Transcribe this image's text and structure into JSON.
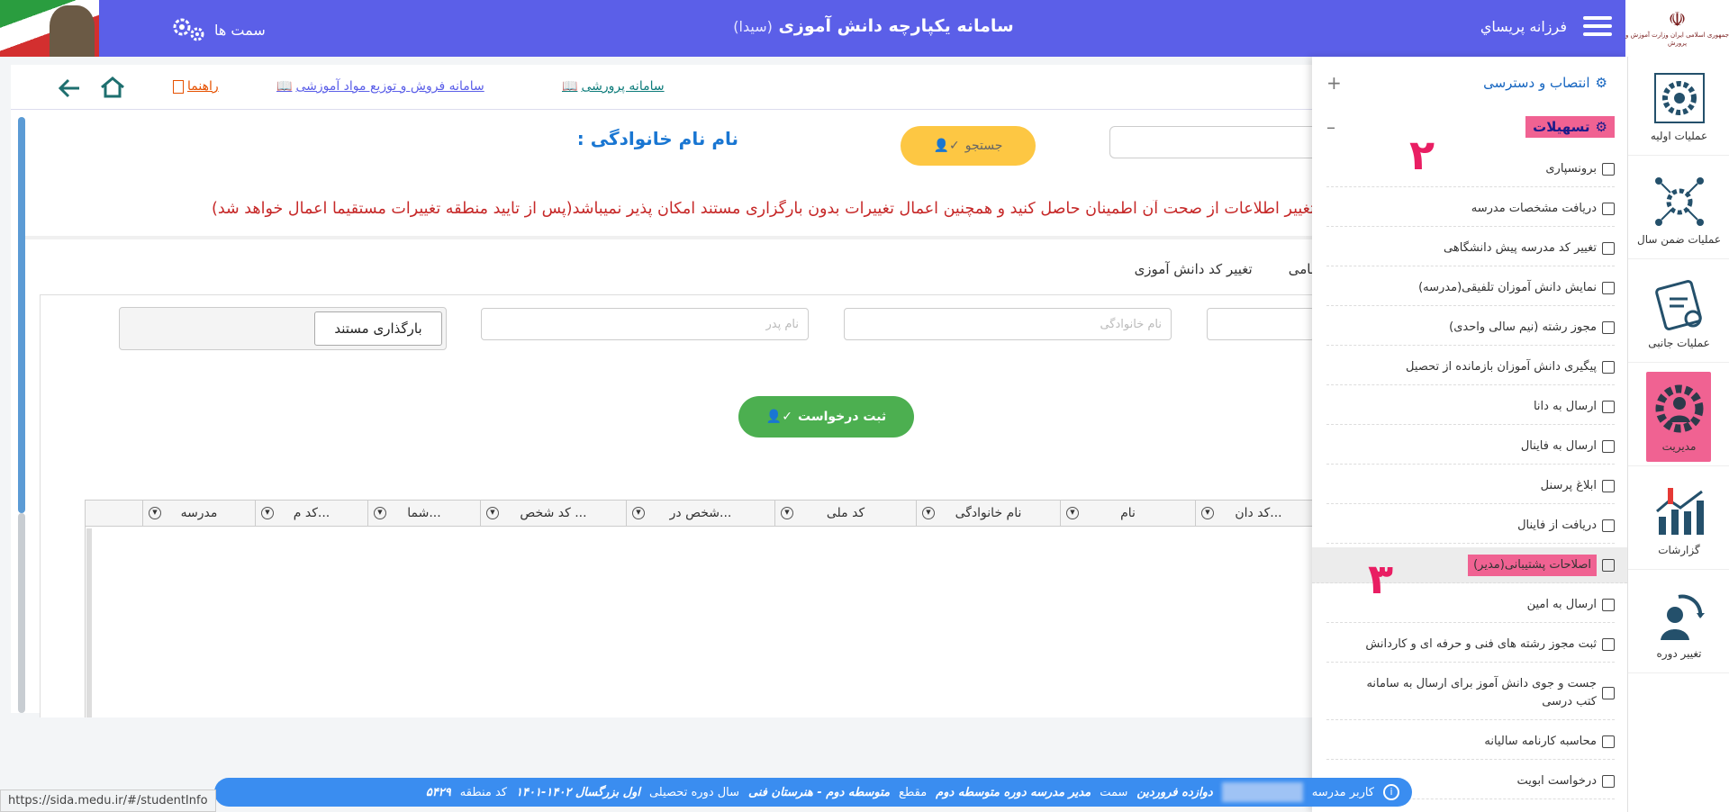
{
  "topbar": {
    "title": "سامانه یکپارچه دانش آموزی",
    "title_suffix": "(سیدا)",
    "user_name": "فرزانه پريساي",
    "roles_label": "سمت ها"
  },
  "toolbar": {
    "parvareshi": "سامانه پرورشی",
    "forosh": "سامانه فروش و توزیع مواد آموزشی",
    "help": "راهنما"
  },
  "search": {
    "button": "جستجو",
    "family_title": "نام نام خانوادگی :"
  },
  "warning": "تغییر اطلاعات از صحت آن اطمینان حاصل کنید و همچنین اعمال تغییرات بدون بارگزاری مستند امکان پذیر نمیباشد(پس از تایید منطقه تغییرات مستقیما اعمال خواهد شد)",
  "tabs": [
    "نامی",
    "تغییر کد دانش آموزی"
  ],
  "form": {
    "family_placeholder": "نام خانوادگی",
    "father_placeholder": "نام پدر",
    "upload_button": "بارگذاری مستند",
    "submit_button": "ثبت درخواست"
  },
  "grid": {
    "headers": [
      "کد دان...",
      "نام",
      "نام خانوادگی",
      "کد ملی",
      "شخص در...",
      "کد شخص ...",
      "شما...",
      "کد م...",
      "مدرسه"
    ]
  },
  "sidebar": {
    "items": [
      "عملیات اولیه",
      "عملیات ضمن سال",
      "عملیات جانبی",
      "مدیریت",
      "گزارشات",
      "تغییر دوره"
    ]
  },
  "submenu": {
    "head1": "انتصاب و دسترسی",
    "head2": "تسهیلات",
    "items": [
      "برونسپاری",
      "دریافت مشخصات مدرسه",
      "تغییر کد مدرسه پیش دانشگاهی",
      "نمایش دانش آموزان تلفیقی(مدرسه)",
      "مجوز رشته (نیم سالی واحدی)",
      "پیگیری دانش آموزان بازمانده از تحصیل",
      "ارسال به دانا",
      "ارسال به فاینال",
      "ابلاغ پرسنل",
      "دریافت از فاینال",
      "اصلاحات پشتیبانی(مدیر)",
      "ارسال به امین",
      "ثبت مجوز رشته های فنی و حرفه ای و کاردانش",
      "جست و جوی دانش آموز برای ارسال به سامانه کتب درسی",
      "محاسبه کارنامه سالیانه",
      "درخواست ابویت"
    ],
    "annot2": "۲",
    "annot3": "۳"
  },
  "status": {
    "user_label": "کاربر مدرسه",
    "school": "دوازده فروردین",
    "role_label": "سمت",
    "role": "مدیر مدرسه دوره متوسطه دوم",
    "level_label": "مقطع",
    "level": "متوسطه دوم - هنرستان فنی",
    "year_label": "سال دوره تحصیلی",
    "year": "اول بزرگسال ۱۴۰۲-۱۴۰۱",
    "region_label": "کد منطقه",
    "region": "۵۴۲۹"
  },
  "url_tip": "https://sida.medu.ir/#/studentInfo",
  "emblem_text": "جمهوری اسلامی ایران وزارت آموزش و پرورش"
}
